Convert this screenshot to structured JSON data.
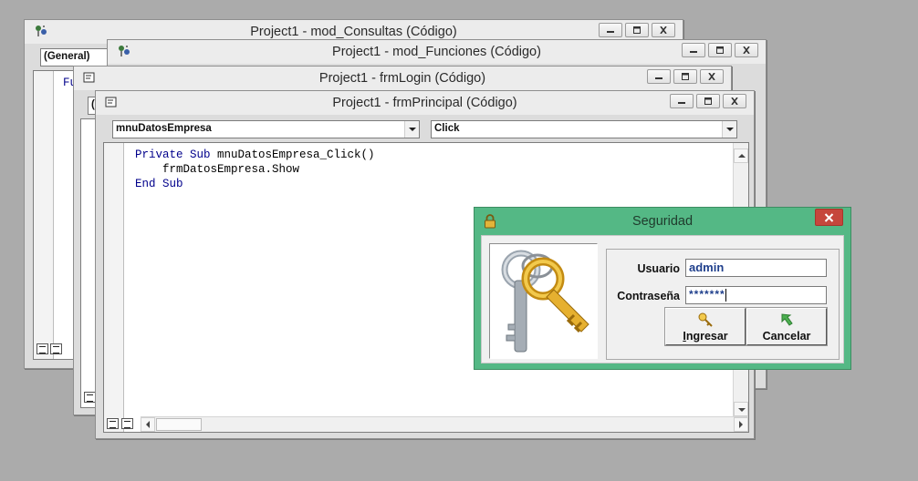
{
  "windows": {
    "consultas": {
      "title": "Project1 - mod_Consultas (Código)",
      "object_combo": "(General)",
      "code_fragment": "Fu"
    },
    "funciones": {
      "title": "Project1 - mod_Funciones (Código)"
    },
    "login": {
      "title": "Project1 - frmLogin (Código)",
      "object_combo_fragment": "("
    },
    "principal": {
      "title": "Project1 - frmPrincipal (Código)",
      "object_combo": "mnuDatosEmpresa",
      "procedure_combo": "Click",
      "code": {
        "kw_private_sub": "Private Sub",
        "proc_name": " mnuDatosEmpresa_Click()",
        "line2": "    frmDatosEmpresa.Show",
        "kw_end_sub": "End Sub"
      }
    }
  },
  "dialog": {
    "title": "Seguridad",
    "usuario_label": "Usuario",
    "usuario_value": "admin",
    "contrasena_label": "Contraseña",
    "contrasena_value": "*******",
    "ingresar_mnemonic": "I",
    "ingresar_rest": "ngresar",
    "cancelar_label": "Cancelar"
  },
  "colors": {
    "desktop": "#ababab",
    "dialog_frame": "#54b885",
    "close_button": "#c6463c",
    "keyword": "#00008b",
    "input_text": "#1f3f8c"
  },
  "icons": [
    "project-icon",
    "code-window-icon",
    "minimize-icon",
    "maximize-icon",
    "close-icon",
    "lock-icon",
    "keys-icon",
    "ingresar-key-icon",
    "cancelar-arrow-icon"
  ]
}
